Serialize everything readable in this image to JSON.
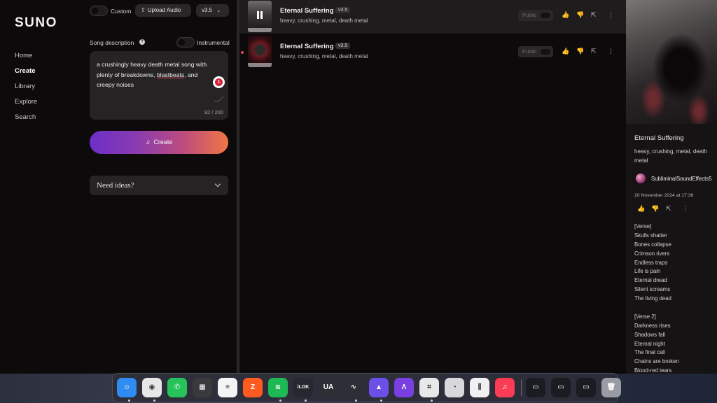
{
  "nav": {
    "logo": "SUNO",
    "items": [
      "Home",
      "Create",
      "Library",
      "Explore",
      "Search"
    ]
  },
  "create": {
    "custom_label": "Custom",
    "upload_label": "Upload Audio",
    "version": "v3.5",
    "song_description_label": "Song description",
    "instrumental_label": "Instrumental",
    "description_before": "a crushingly heavy death metal song with plenty of breakdowns, ",
    "description_misspelled": "blastbeats",
    "description_after": ", and creepy noises",
    "char_count": "92 / 200",
    "grammar_badge": "1",
    "create_button": "Create",
    "need_ideas": "Need ideas?"
  },
  "songs": [
    {
      "title": "Eternal Suffering",
      "version": "v3.5",
      "tags": "heavy, crushing, metal, death metal",
      "public_label": "Public",
      "playing": true
    },
    {
      "title": "Eternal Suffering",
      "version": "v3.5",
      "tags": "heavy, crushing, metal, death metal",
      "public_label": "Public",
      "playing": false
    }
  ],
  "detail": {
    "title": "Eternal Suffering",
    "tags": "heavy, crushing, metal, death metal",
    "user": "SubliminalSoundEffects5",
    "date": "20 November 2024 at 17:36",
    "lyrics": [
      "[Verse]",
      "Skulls shatter",
      "Bones collapse",
      "Crimson rivers",
      "Endless traps",
      "Life is pain",
      "Eternal dread",
      "Silent screams",
      "The living dead",
      "",
      "[Verse 2]",
      "Darkness rises",
      "Shadows fall",
      "Eternal night",
      "The final call",
      "Chains are broken",
      "Blood-red tears"
    ]
  },
  "dock": {
    "apps": [
      {
        "name": "finder-icon",
        "color": "#2f8cf0",
        "glyph": "☺"
      },
      {
        "name": "chrome-icon",
        "color": "#e7e7e7",
        "glyph": "◉"
      },
      {
        "name": "whatsapp-icon",
        "color": "#25c35a",
        "glyph": "✆"
      },
      {
        "name": "calculator-icon",
        "color": "#3a3a3c",
        "glyph": "▦"
      },
      {
        "name": "notes-icon",
        "color": "#f4f4f4",
        "glyph": "≡"
      },
      {
        "name": "zapier-icon",
        "color": "#ff5a1f",
        "glyph": "Z"
      },
      {
        "name": "spotify-icon",
        "color": "#1db954",
        "glyph": "≋"
      },
      {
        "name": "ilok-icon",
        "color": "#26282f",
        "glyph": "iLOK"
      },
      {
        "name": "universal-audio-icon",
        "color": "#2d2f36",
        "glyph": "UA"
      },
      {
        "name": "waveform-app-icon",
        "color": "#2d2f36",
        "glyph": "∿"
      },
      {
        "name": "arc-blue-icon",
        "color": "#6b4fe6",
        "glyph": "▲"
      },
      {
        "name": "arc-purple-icon",
        "color": "#7a3fe0",
        "glyph": "Λ"
      },
      {
        "name": "shifter-icon",
        "color": "#e8e8ea",
        "glyph": "⌗"
      },
      {
        "name": "gauge-icon",
        "color": "#d8d8dc",
        "glyph": "◔"
      },
      {
        "name": "mixer-icon",
        "color": "#f0f0f2",
        "glyph": "⫼"
      },
      {
        "name": "music-icon",
        "color": "#fa3c55",
        "glyph": "♫"
      }
    ],
    "recent": [
      {
        "name": "recent-window-1-icon",
        "color": "#1a1c22",
        "glyph": "▭"
      },
      {
        "name": "recent-window-2-icon",
        "color": "#1a1c22",
        "glyph": "▭"
      },
      {
        "name": "recent-window-3-icon",
        "color": "#1a1c22",
        "glyph": "▭"
      },
      {
        "name": "trash-icon",
        "color": "#9a9ca5",
        "glyph": "🗑"
      }
    ]
  }
}
